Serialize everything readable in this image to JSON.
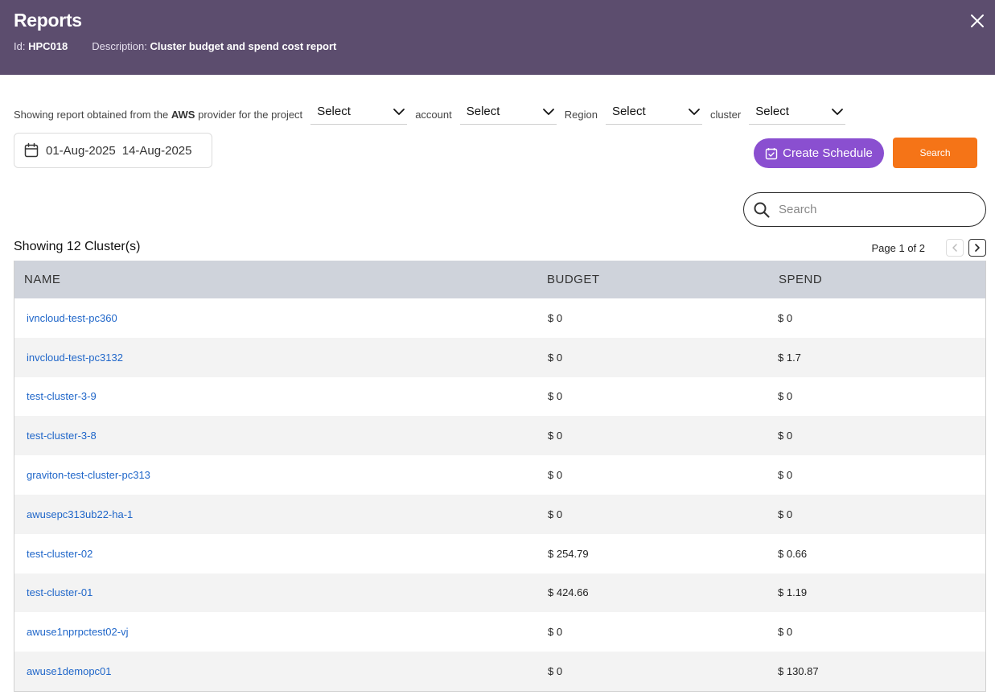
{
  "header": {
    "title": "Reports",
    "id_label": "Id:",
    "id_value": "HPC018",
    "desc_label": "Description:",
    "desc_value": "Cluster budget and spend cost report"
  },
  "filters": {
    "prefix_text": "Showing report obtained from the",
    "provider": "AWS",
    "provider_suffix": "provider for the project",
    "project_value": "Select",
    "account_label": "account",
    "account_value": "Select",
    "region_label": "Region",
    "region_value": "Select",
    "cluster_label": "cluster",
    "cluster_value": "Select"
  },
  "date_range": {
    "start": "01-Aug-2025",
    "end": "14-Aug-2025"
  },
  "actions": {
    "create_schedule_label": "Create Schedule",
    "search_label": "Search"
  },
  "table_search": {
    "placeholder": "Search"
  },
  "summary": {
    "showing_text": "Showing 12 Cluster(s)"
  },
  "pagination": {
    "text": "Page 1 of 2"
  },
  "table": {
    "headers": [
      "NAME",
      "BUDGET",
      "SPEND"
    ],
    "rows": [
      [
        "ivncloud-test-pc360",
        "$ 0",
        "$ 0"
      ],
      [
        "invcloud-test-pc3132",
        "$ 0",
        "$ 1.7"
      ],
      [
        "test-cluster-3-9",
        "$ 0",
        "$ 0"
      ],
      [
        "test-cluster-3-8",
        "$ 0",
        "$ 0"
      ],
      [
        "graviton-test-cluster-pc313",
        "$ 0",
        "$ 0"
      ],
      [
        "awusepc313ub22-ha-1",
        "$ 0",
        "$ 0"
      ],
      [
        "test-cluster-02",
        "$ 254.79",
        "$ 0.66"
      ],
      [
        "test-cluster-01",
        "$ 424.66",
        "$ 1.19"
      ],
      [
        "awuse1nprpctest02-vj",
        "$ 0",
        "$ 0"
      ],
      [
        "awuse1demopc01",
        "$ 0",
        "$ 130.87"
      ]
    ]
  },
  "colors": {
    "header_bg": "#5c4d6e",
    "schedule_button": "#8a4fd0",
    "search_button": "#f57417",
    "link": "#1f66c9",
    "table_header_bg": "#cfd3db"
  }
}
